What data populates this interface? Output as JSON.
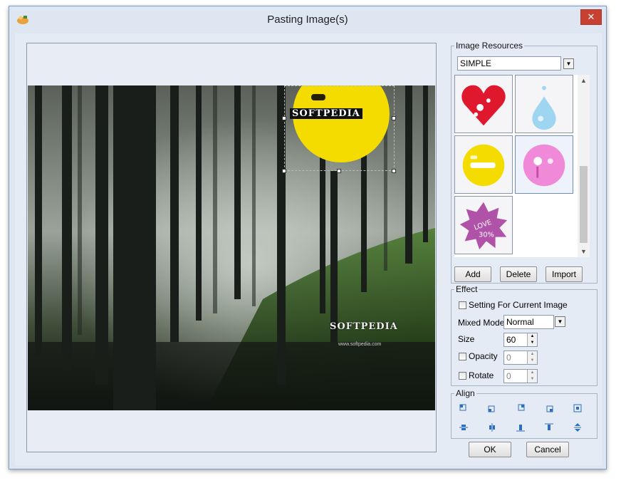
{
  "window": {
    "title": "Pasting Image(s)",
    "close_label": "✕"
  },
  "canvas": {
    "watermark_main": "SOFTPEDIA",
    "watermark_logo": "SOFTPEDIA",
    "watermark_url": "www.softpedia.com"
  },
  "resources": {
    "legend": "Image Resources",
    "selected_set": "SIMPLE",
    "thumbnails": [
      "broken-heart",
      "water-drop",
      "yellow-button",
      "pink-button",
      "love-30-starburst"
    ],
    "add_label": "Add",
    "delete_label": "Delete",
    "import_label": "Import"
  },
  "effect": {
    "legend": "Effect",
    "current_image_label": "Setting For Current Image",
    "mixed_mode_label": "Mixed Mode",
    "mixed_mode_value": "Normal",
    "size_label": "Size",
    "size_value": "60",
    "opacity_label": "Opacity",
    "opacity_value": "0",
    "rotate_label": "Rotate",
    "rotate_value": "0"
  },
  "align": {
    "legend": "Align",
    "buttons": [
      "align-top-left",
      "align-bottom-left",
      "align-top-right",
      "align-bottom-right",
      "align-center",
      "align-middle-horizontal",
      "align-middle-vertical",
      "align-bottom",
      "align-top",
      "align-stretch-vertical"
    ]
  },
  "footer": {
    "ok_label": "OK",
    "cancel_label": "Cancel"
  },
  "colors": {
    "accent_yellow": "#f5dc00",
    "accent_pink": "#f08ad8",
    "heart_red": "#e0182e",
    "close_red": "#c84031",
    "icon_blue": "#2a6fc0"
  },
  "love_text": "LOVE",
  "love_value": "30%"
}
